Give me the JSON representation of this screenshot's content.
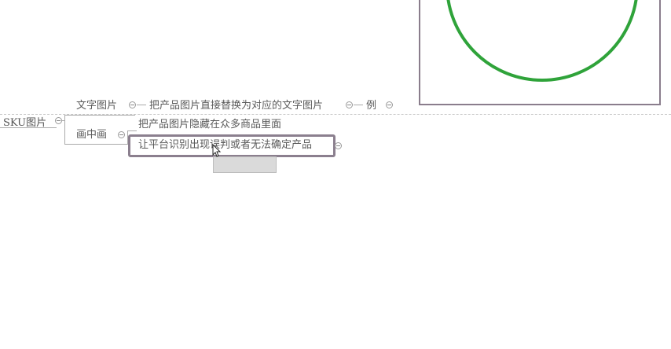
{
  "mindmap": {
    "root": {
      "label": "SKU图片"
    },
    "branches": [
      {
        "label": "文字图片",
        "child": "把产品图片直接替换为对应的文字图片",
        "grandchild": "例"
      },
      {
        "label": "画中画",
        "children": [
          "把产品图片隐藏在众多商品里面",
          "让平台识别出现误判或者无法确定产品"
        ]
      }
    ]
  },
  "colors": {
    "circle_stroke": "#2fa33a",
    "frame_border": "#8a7d8c",
    "highlight_border": "#8b7f8e"
  },
  "icons": [
    "collapse-toggle-icon",
    "mouse-cursor-icon"
  ]
}
